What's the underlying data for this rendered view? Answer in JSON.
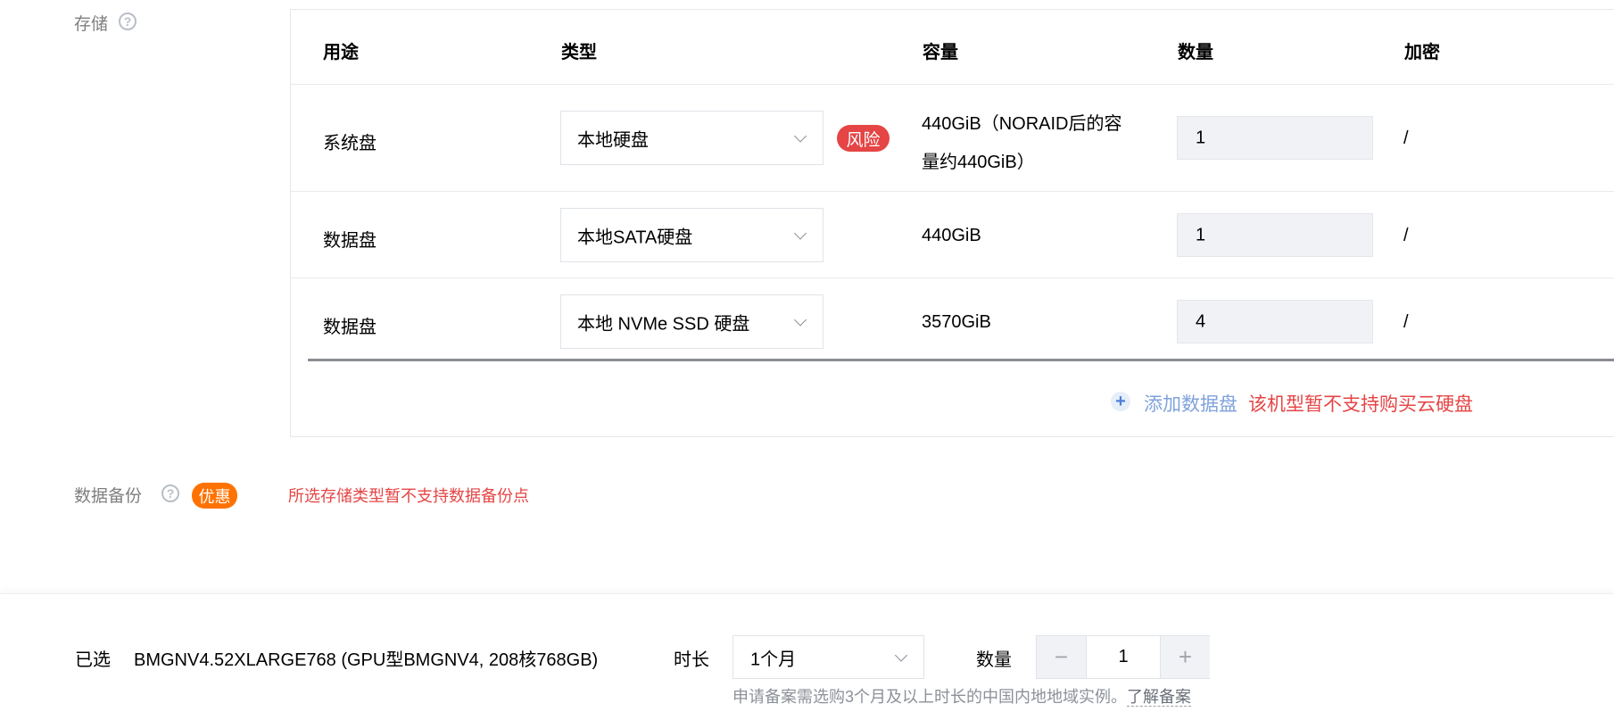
{
  "storage": {
    "label": "存储",
    "help_icon": "question-circle-icon",
    "headers": {
      "usage": "用途",
      "type": "类型",
      "capacity": "容量",
      "quantity": "数量",
      "encryption": "加密"
    },
    "rows": [
      {
        "usage": "系统盘",
        "type": "本地硬盘",
        "badge": "风险",
        "capacity_line1": "440GiB（NORAID后的容",
        "capacity_line2": "量约440GiB）",
        "quantity": "1",
        "encryption": "/"
      },
      {
        "usage": "数据盘",
        "type": "本地SATA硬盘",
        "capacity": "440GiB",
        "quantity": "1",
        "encryption": "/"
      },
      {
        "usage": "数据盘",
        "type": "本地 NVMe SSD 硬盘",
        "capacity": "3570GiB",
        "quantity": "4",
        "encryption": "/"
      }
    ],
    "add_disk": {
      "icon": "plus-circle-icon",
      "label": "添加数据盘",
      "warning": "该机型暂不支持购买云硬盘"
    }
  },
  "backup": {
    "label": "数据备份",
    "badge": "优惠",
    "notice": "所选存储类型暂不支持数据备份点"
  },
  "footer": {
    "selected_label": "已选",
    "selected_value": "BMGNV4.52XLARGE768 (GPU型BMGNV4, 208核768GB)",
    "duration_label": "时长",
    "duration_value": "1个月",
    "duration_hint": "申请备案需选购3个月及以上时长的中国内地地域实例。",
    "duration_link": "了解备案",
    "quantity_label": "数量",
    "quantity_value": "1",
    "minus": "−",
    "plus": "+"
  },
  "colors": {
    "accent_blue": "#4f7fd6",
    "danger_red": "#e54545",
    "promo_orange": "#ff7200"
  }
}
